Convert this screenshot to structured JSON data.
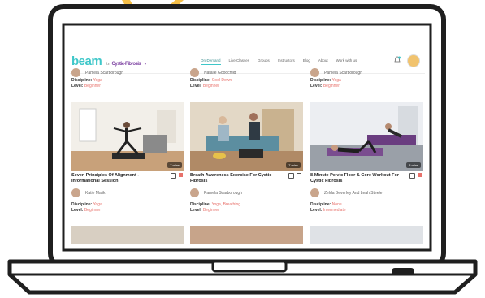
{
  "brand": {
    "logo": "beam",
    "for_label": "for",
    "condition": "Cystic-Fibrosis",
    "accent": "#3ec7c9",
    "condition_color": "#7b3fa0"
  },
  "nav": {
    "items": [
      "On-Demand",
      "Live Classes",
      "Groups",
      "Instructors",
      "Blog",
      "About",
      "Work with us"
    ]
  },
  "top_cards": [
    {
      "author": "Pamela Scarborough",
      "discipline_label": "Discipline:",
      "discipline": "Yoga",
      "level_label": "Level:",
      "level": "Beginner"
    },
    {
      "author": "Natalie Goodchild",
      "discipline_label": "Discipline:",
      "discipline": "Cool Down",
      "level_label": "Level:",
      "level": "Beginner"
    },
    {
      "author": "Pamela Scarborough",
      "discipline_label": "Discipline:",
      "discipline": "Yoga",
      "level_label": "Level:",
      "level": "Beginner"
    }
  ],
  "cards": [
    {
      "title": "Seven Principles Of Alignment - Informational Session",
      "duration": "7 mins",
      "author": "Katie Malik",
      "discipline_label": "Discipline:",
      "discipline": "Yoga",
      "level_label": "Level:",
      "level": "Beginner"
    },
    {
      "title": "Breath Awareness Exercise For Cystic Fibrosis",
      "duration": "7 mins",
      "author": "Pamela Scarborough",
      "discipline_label": "Discipline:",
      "discipline": "Yoga, Breathing",
      "level_label": "Level:",
      "level": "Beginner"
    },
    {
      "title": "8-Minute Pelvic Floor & Core Workout For Cystic Fibrosis",
      "duration": "8 mins",
      "author": "Zelda Beverley And Leah Steele",
      "discipline_label": "Discipline:",
      "discipline": "None",
      "level_label": "Level:",
      "level": "Intermediate"
    }
  ]
}
